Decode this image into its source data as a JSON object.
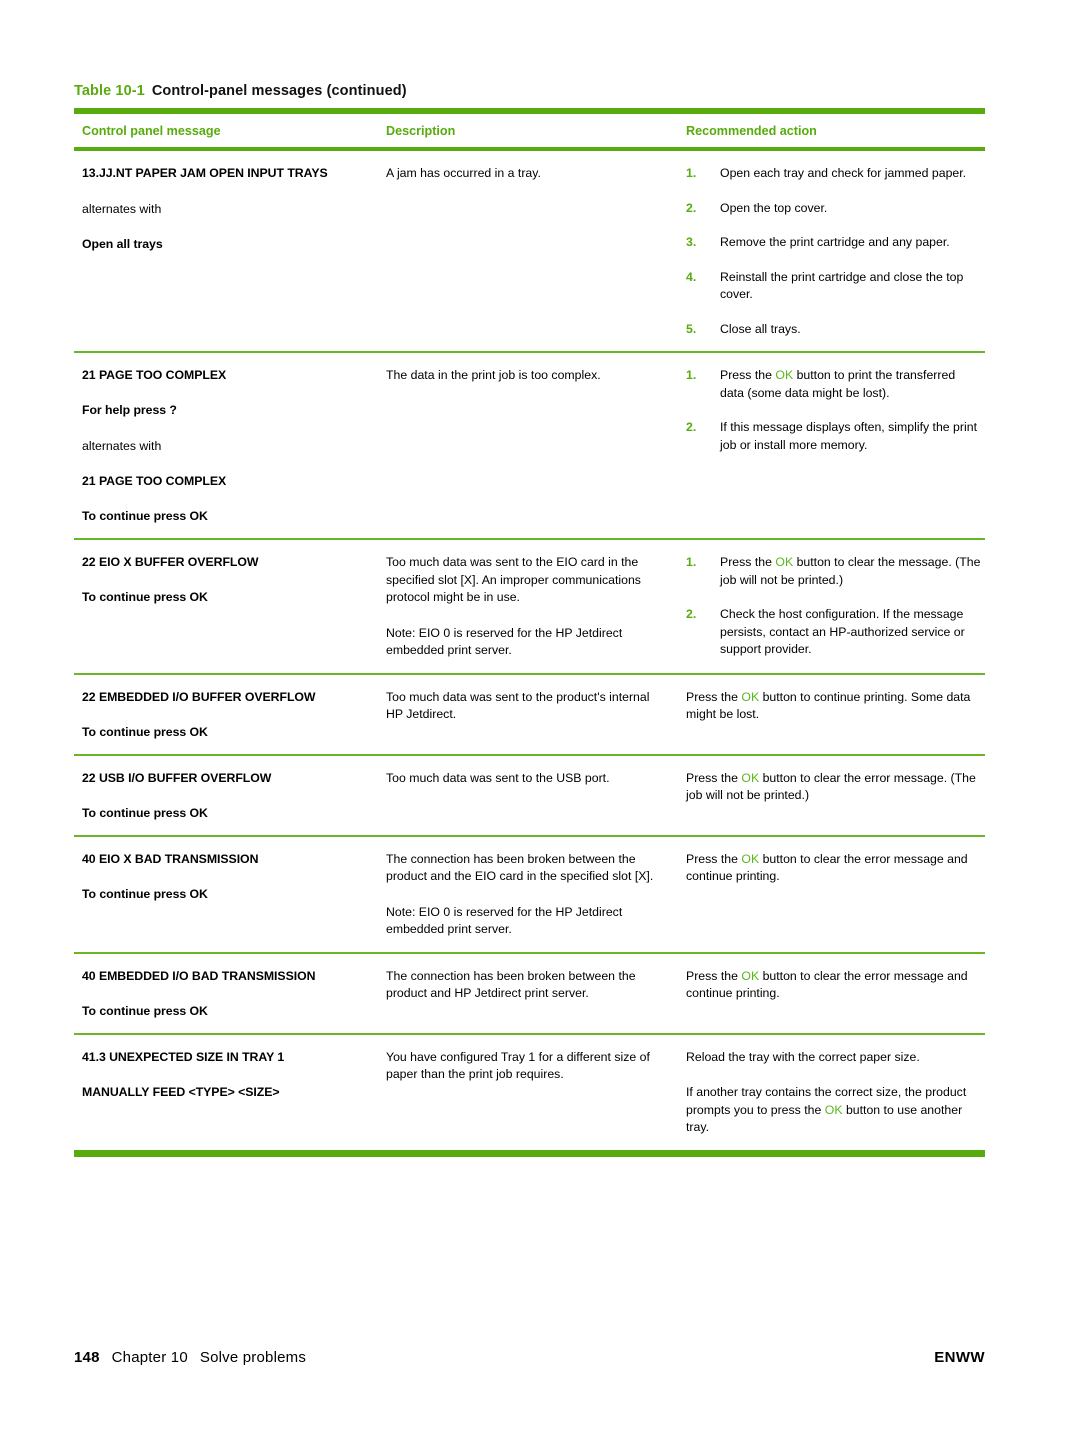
{
  "caption": {
    "number": "Table 10-1",
    "text": "Control-panel messages (continued)"
  },
  "colors": {
    "accent_green": "#57ab0d",
    "ok_green": "#5ab81b",
    "text": "#000000"
  },
  "table": {
    "headers": {
      "message": "Control panel message",
      "description": "Description",
      "action": "Recommended action"
    },
    "rows": [
      {
        "message": {
          "main": "13.JJ.NT PAPER JAM OPEN INPUT TRAYS",
          "plain": "alternates with",
          "sub": "Open all trays"
        },
        "description": [
          "A jam has occurred in a tray."
        ],
        "action_list": [
          "Open each tray and check for jammed paper.",
          "Open the top cover.",
          "Remove the print cartridge and any paper.",
          "Reinstall the print cartridge and close the top cover.",
          "Close all trays."
        ],
        "action_numbers": [
          "1.",
          "2.",
          "3.",
          "4.",
          "5."
        ]
      },
      {
        "message": {
          "main": "21 PAGE TOO COMPLEX",
          "sub1": "For help press ?",
          "plain": "alternates with",
          "sub2": "21 PAGE TOO COMPLEX",
          "sub3": "To continue press OK"
        },
        "description": [
          "The data in the print job is too complex."
        ],
        "action_list": [
          "Press the OK button to print the transferred data (some data might be lost).",
          "If this message displays often, simplify the print job or install more memory."
        ],
        "action_numbers": [
          "1.",
          "2."
        ],
        "action_ok_tokens": [
          "OK",
          ""
        ]
      },
      {
        "message": {
          "main": "22 EIO X BUFFER OVERFLOW",
          "sub": "To continue press OK"
        },
        "description": [
          "Too much data was sent to the EIO card in the specified slot [X]. An improper communications protocol might be in use.",
          "Note: EIO 0 is reserved for the HP Jetdirect embedded print server."
        ],
        "action_list": [
          "Press the OK button to clear the message. (The job will not be printed.)",
          "Check the host configuration. If the message persists, contact an HP-authorized service or support provider."
        ],
        "action_numbers": [
          "1.",
          "2."
        ]
      },
      {
        "message": {
          "main": "22 EMBEDDED I/O BUFFER OVERFLOW",
          "sub": "To continue press OK"
        },
        "description": [
          "Too much data was sent to the product's internal HP Jetdirect."
        ],
        "action_paras": [
          "Press the OK button to continue printing. Some data might be lost."
        ]
      },
      {
        "message": {
          "main": "22 USB I/O BUFFER OVERFLOW",
          "sub": "To continue press OK"
        },
        "description": [
          "Too much data was sent to the USB port."
        ],
        "action_paras": [
          "Press the OK button to clear the error message. (The job will not be printed.)"
        ]
      },
      {
        "message": {
          "main": "40 EIO X BAD TRANSMISSION",
          "sub": "To continue press OK"
        },
        "description": [
          "The connection has been broken between the product and the EIO card in the specified slot [X].",
          "Note: EIO 0 is reserved for the HP Jetdirect embedded print server."
        ],
        "action_paras": [
          "Press the OK button to clear the error message and continue printing."
        ]
      },
      {
        "message": {
          "main": "40 EMBEDDED I/O BAD TRANSMISSION",
          "sub": "To continue press OK"
        },
        "description": [
          "The connection has been broken between the product and HP Jetdirect print server."
        ],
        "action_paras": [
          "Press the OK button to clear the error message and continue printing."
        ]
      },
      {
        "message": {
          "main": "41.3 UNEXPECTED SIZE IN TRAY 1",
          "sub": "MANUALLY FEED <TYPE> <SIZE>"
        },
        "description": [
          "You have configured Tray 1 for a different size of paper than the print job requires."
        ],
        "action_paras": [
          "Reload the tray with the correct paper size.",
          "If another tray contains the correct size, the product prompts you to press the OK button to use another tray."
        ]
      }
    ]
  },
  "footer": {
    "page_number": "148",
    "chapter": "Chapter 10",
    "chapter_title": "Solve problems",
    "locale": "ENWW"
  }
}
